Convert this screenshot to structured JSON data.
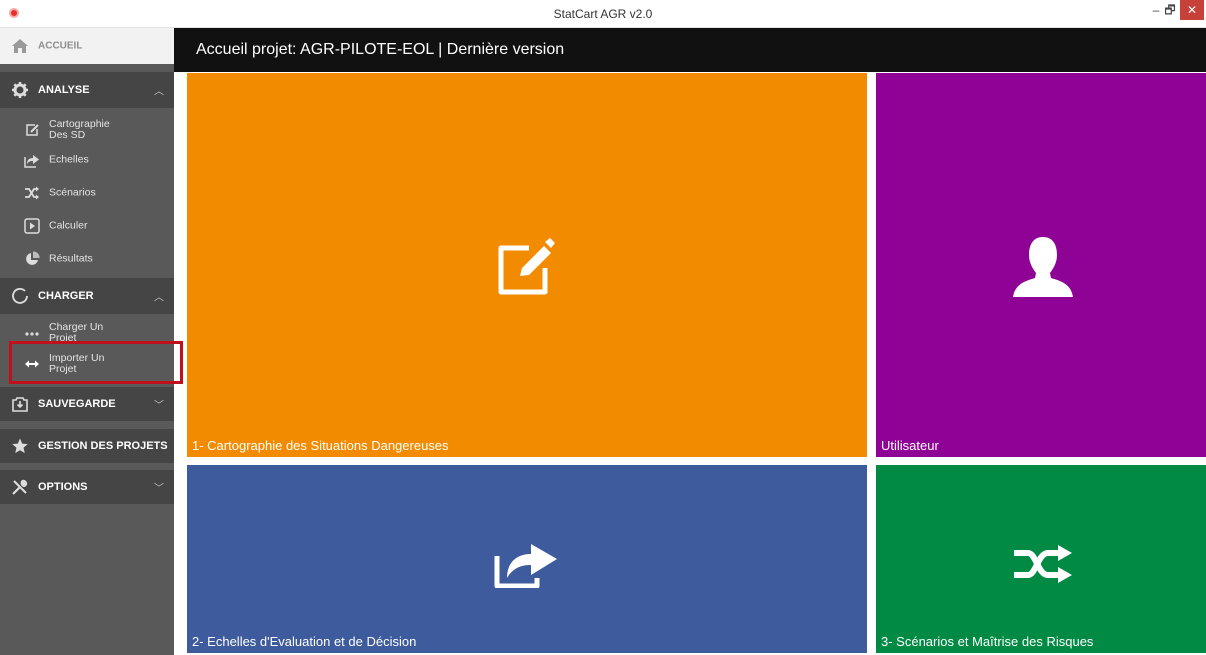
{
  "window": {
    "title": "StatCart AGR v2.0",
    "minimize": "–",
    "maximize": "🗗",
    "close": "✕"
  },
  "sidebar": {
    "home": "ACCUEIL",
    "analyse": {
      "label": "ANALYSE",
      "items": [
        {
          "line1": "Cartographie",
          "line2": "Des SD"
        },
        {
          "line1": "Echelles",
          "line2": ""
        },
        {
          "line1": "Scénarios",
          "line2": ""
        },
        {
          "line1": "Calculer",
          "line2": ""
        },
        {
          "line1": "Résultats",
          "line2": ""
        }
      ]
    },
    "charger": {
      "label": "CHARGER",
      "items": [
        {
          "line1": "Charger Un",
          "line2": "Projet"
        },
        {
          "line1": "Importer Un",
          "line2": "Projet"
        }
      ]
    },
    "sauvegarde": "SAUVEGARDE",
    "gestion": "GESTION DES PROJETS",
    "options": "OPTIONS"
  },
  "header": {
    "title": "Accueil projet: AGR-PILOTE-EOL | Dernière version"
  },
  "tiles": [
    {
      "label": "1- Cartographie des Situations Dangereuses",
      "icon": "edit-icon",
      "color": "#f28b00"
    },
    {
      "label": "Utilisateur",
      "icon": "user-icon",
      "color": "#8f0296"
    },
    {
      "label": "2- Echelles d'Evaluation et de Décision",
      "icon": "share-icon",
      "color": "#3e5b9d"
    },
    {
      "label": "3- Scénarios et Maîtrise des Risques",
      "icon": "shuffle-icon",
      "color": "#008a43"
    }
  ],
  "accent": {
    "highlight": "#c0101b"
  }
}
